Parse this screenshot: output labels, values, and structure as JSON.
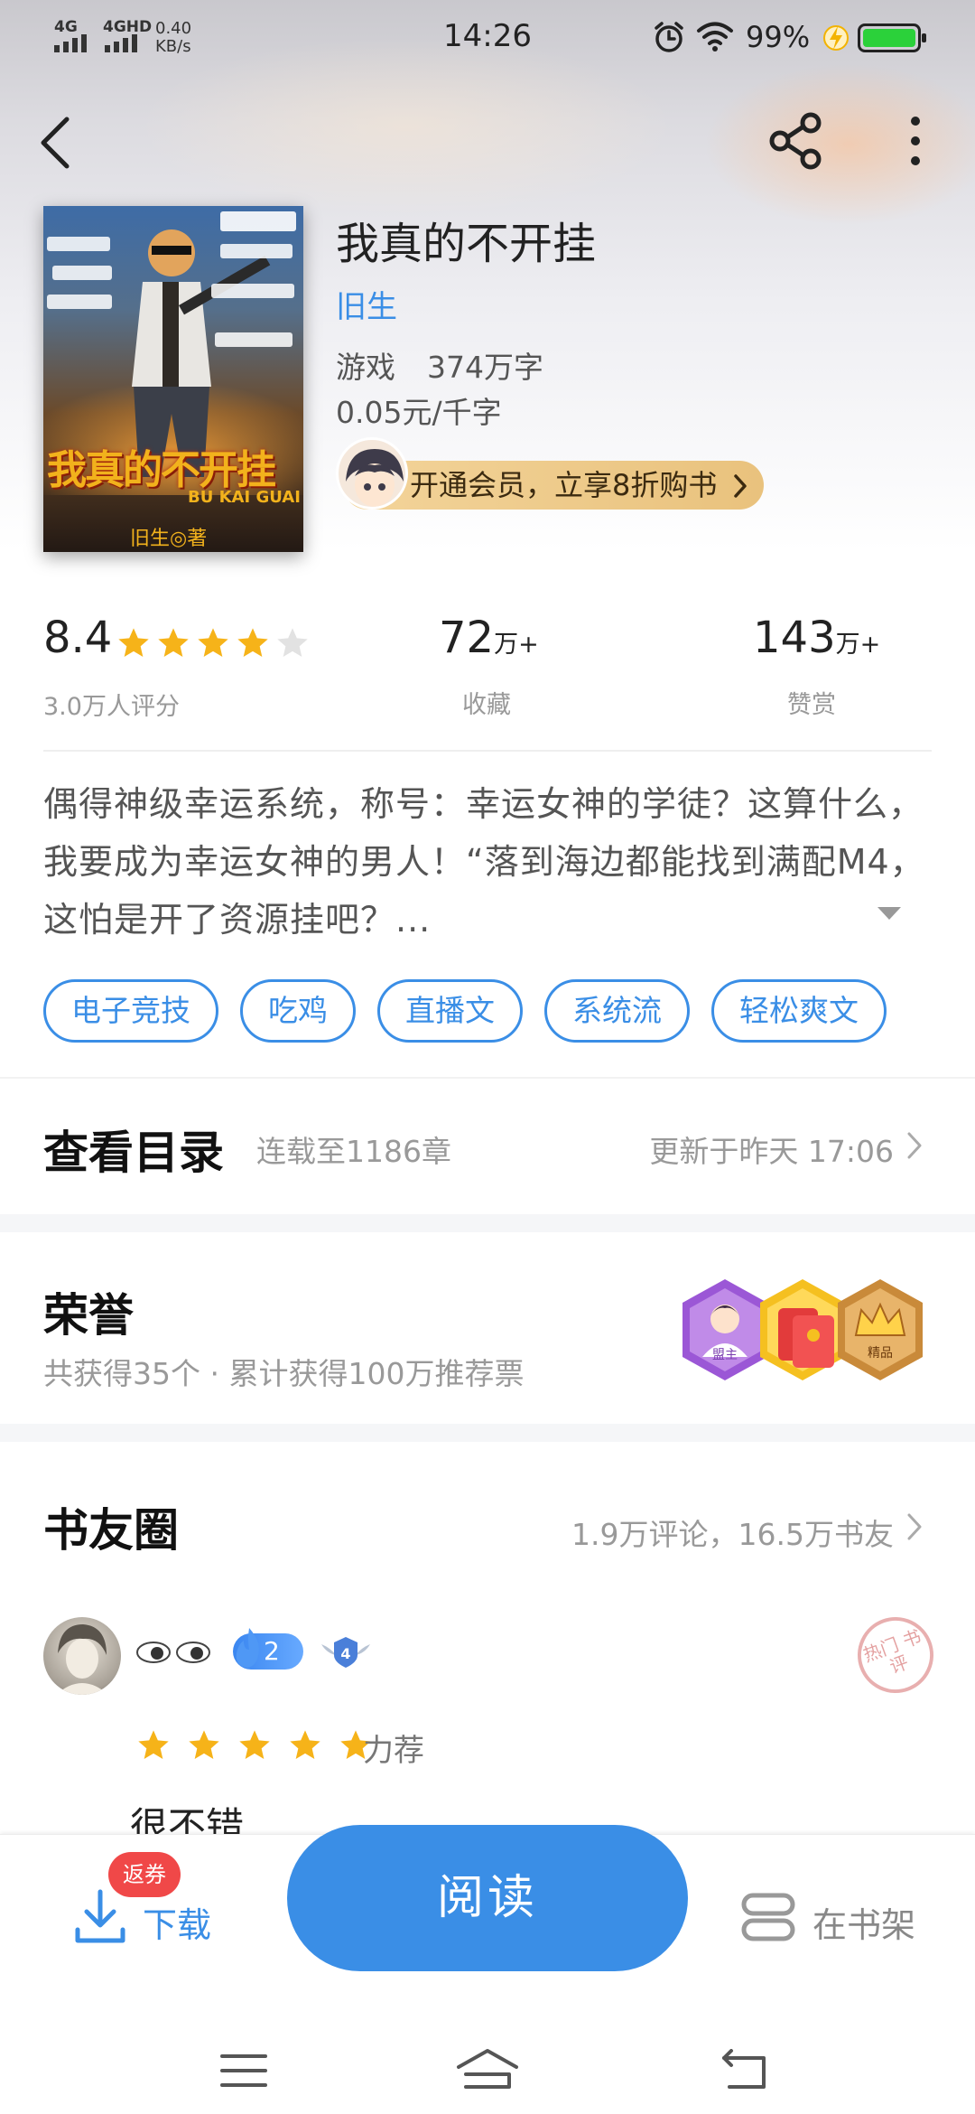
{
  "status_bar": {
    "signal_1": "4G",
    "signal_2": "4GHD",
    "net_speed": "0.40",
    "net_unit": "KB/s",
    "time": "14:26",
    "battery": "99%"
  },
  "header": {
    "back_icon": "back-arrow-icon",
    "share_icon": "share-icon",
    "more_icon": "more-vertical-icon"
  },
  "book": {
    "cover_title": "我真的不开挂",
    "cover_subtitle": "BU KAI GUAI",
    "cover_author": "旧生◎著",
    "title": "我真的不开挂",
    "author": "旧生",
    "genre": "游戏",
    "word_count": "374万字",
    "price": "0.05元/千字",
    "vip_promo": "开通会员，立享8折购书"
  },
  "stats": {
    "score": "8.4",
    "stars": 4,
    "rating_count": "3.0万人评分",
    "favorites_num": "72",
    "favorites_unit": "万+",
    "favorites_label": "收藏",
    "rewards_num": "143",
    "rewards_unit": "万+",
    "rewards_label": "赞赏"
  },
  "synopsis": "偶得神级幸运系统，称号：幸运女神的学徒？这算什么，我要成为幸运女神的男人！“落到海边都能找到满配M4，这怕是开了资源挂吧？...",
  "tags": [
    "电子竞技",
    "吃鸡",
    "直播文",
    "系统流",
    "轻松爽文"
  ],
  "catalog": {
    "title": "查看目录",
    "progress": "连载至1186章",
    "updated": "更新于昨天 17:06"
  },
  "honor": {
    "title": "荣誉",
    "summary": "共获得35个 · 累计获得100万推荐票",
    "badges": [
      {
        "label": "盟主",
        "color": "#9b57d6"
      },
      {
        "label": "",
        "color": "#f5c020"
      },
      {
        "label": "精品",
        "color": "#c98a3a"
      }
    ]
  },
  "circle": {
    "title": "书友圈",
    "summary": "1.9万评论，16.5万书友"
  },
  "comment": {
    "level": "2",
    "rank": "4",
    "stamp": "热门 书评",
    "rating_stars": 5,
    "rating_word": "力荐",
    "text": "很不错"
  },
  "bottom_bar": {
    "coupon": "返券",
    "download": "下载",
    "read": "阅读",
    "shelf": "在书架"
  },
  "colors": {
    "accent": "#3a8ee6",
    "star": "#f6b319",
    "coupon": "#f04848"
  }
}
